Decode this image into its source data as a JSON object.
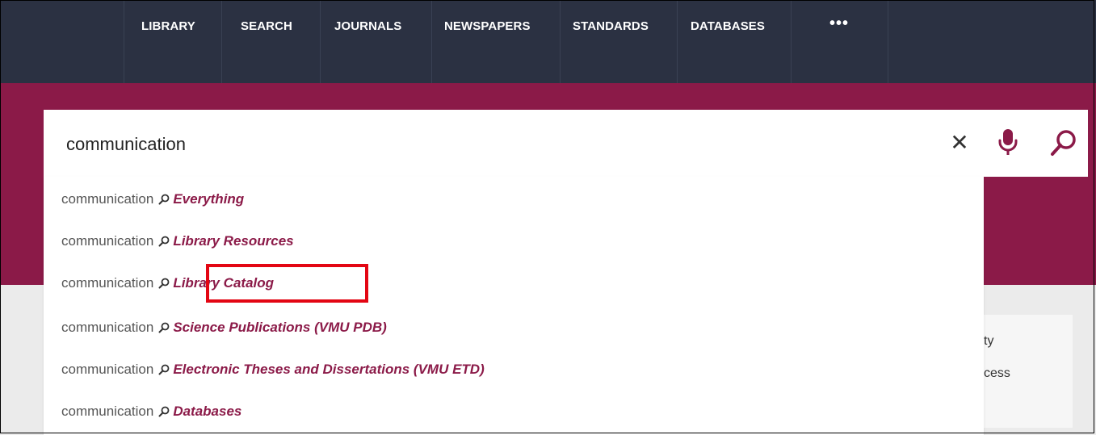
{
  "nav": {
    "items": [
      {
        "label": "LIBRARY"
      },
      {
        "label": "SEARCH"
      },
      {
        "label": "JOURNALS"
      },
      {
        "label": "NEWSPAPERS"
      },
      {
        "label": "STANDARDS"
      },
      {
        "label": "DATABASES"
      }
    ],
    "more_label": "•••"
  },
  "search": {
    "value": "communication",
    "clear_label": "✕",
    "mic_icon": "microphone-icon",
    "search_icon": "search-icon"
  },
  "suggestions": [
    {
      "term": "communication",
      "scope": "Everything"
    },
    {
      "term": "communication",
      "scope": "Library Resources"
    },
    {
      "term": "communication",
      "scope": "Library Catalog"
    },
    {
      "term": "communication",
      "scope": "Science Publications (VMU PDB)"
    },
    {
      "term": "communication",
      "scope": "Electronic Theses and Dissertations (VMU ETD)"
    },
    {
      "term": "communication",
      "scope": "Databases"
    }
  ],
  "background_card": {
    "line1": "ty",
    "line2": "cess"
  },
  "colors": {
    "nav_bg": "#2b3142",
    "brand": "#8b1a48",
    "highlight": "#e30613"
  }
}
